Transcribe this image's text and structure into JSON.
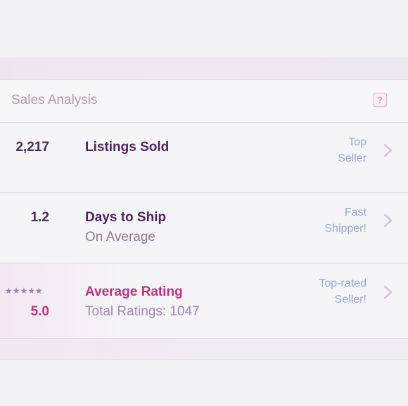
{
  "header": {
    "title": "Sales Analysis",
    "help_label": "?"
  },
  "rows": [
    {
      "metric": "2,217",
      "label": "Listings Sold",
      "sublabel": "",
      "badge_line1": "Top",
      "badge_line2": "Seller"
    },
    {
      "metric": "1.2",
      "label": "Days to Ship",
      "sublabel": "On Average",
      "badge_line1": "Fast",
      "badge_line2": "Shipper!"
    },
    {
      "stars": "★★★★★",
      "stars_value": 5,
      "metric": "5.0",
      "label": "Average Rating",
      "sublabel": "Total Ratings: 1047",
      "badge_line1": "Top-rated",
      "badge_line2": "Seller!"
    }
  ],
  "icons": {
    "help": "question-icon",
    "chevron": "chevron-right-icon",
    "star": "star-icon"
  },
  "colors": {
    "label_dark": "#4e2660",
    "rating_pink": "#c2307f",
    "badge_blue": "#96a8d6",
    "chevron": "#d6c5e0",
    "header_title": "#a89bb4"
  }
}
